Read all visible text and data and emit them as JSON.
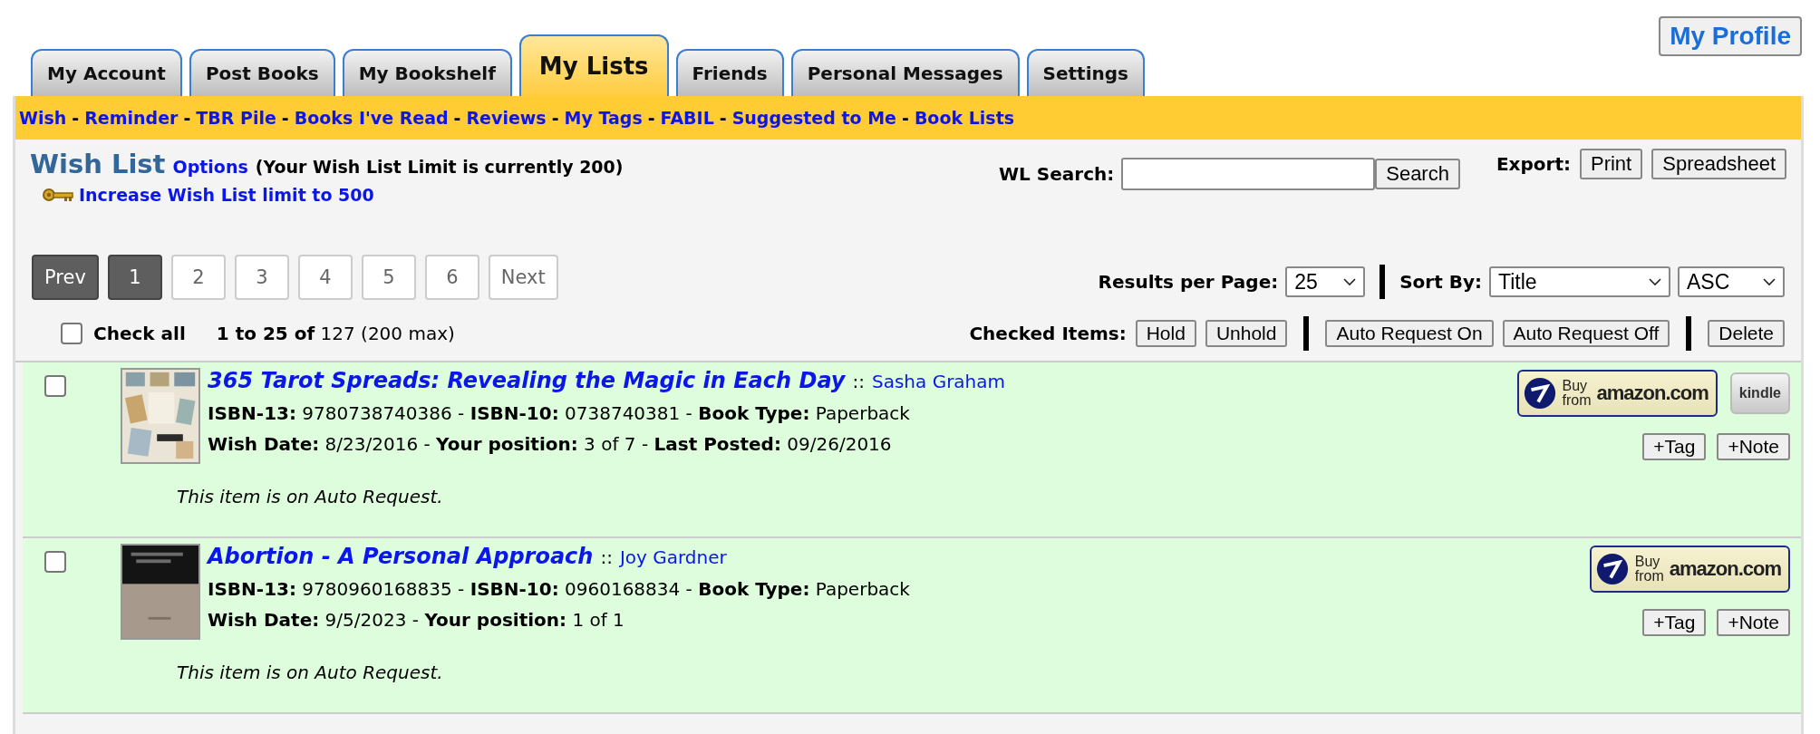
{
  "profile_button": {
    "label": "My Profile"
  },
  "tabs": [
    {
      "label": "My Account",
      "selected": false
    },
    {
      "label": "Post Books",
      "selected": false
    },
    {
      "label": "My Bookshelf",
      "selected": false
    },
    {
      "label": "My Lists",
      "selected": true
    },
    {
      "label": "Friends",
      "selected": false
    },
    {
      "label": "Personal Messages",
      "selected": false
    },
    {
      "label": "Settings",
      "selected": false
    }
  ],
  "subnav": {
    "separator": "-",
    "links": [
      "Wish",
      "Reminder",
      "TBR Pile",
      "Books I've Read",
      "Reviews",
      "My Tags",
      "FABIL",
      "Suggested to Me",
      "Book Lists"
    ]
  },
  "heading": {
    "title": "Wish List",
    "options_link": "Options",
    "note": "(Your Wish List Limit is currently 200)",
    "upgrade_link": "Increase Wish List limit to 500"
  },
  "search": {
    "label": "WL Search:",
    "button": "Search"
  },
  "export": {
    "label": "Export:",
    "buttons": [
      "Print",
      "Spreadsheet"
    ]
  },
  "pager": [
    {
      "label": "Prev",
      "highlighted": true
    },
    {
      "label": "1",
      "highlighted": true
    },
    {
      "label": "2",
      "highlighted": false
    },
    {
      "label": "3",
      "highlighted": false
    },
    {
      "label": "4",
      "highlighted": false
    },
    {
      "label": "5",
      "highlighted": false
    },
    {
      "label": "6",
      "highlighted": false
    },
    {
      "label": "Next",
      "highlighted": false
    }
  ],
  "results_per_page": {
    "label": "Results per Page:",
    "value": "25"
  },
  "sort": {
    "label": "Sort By:",
    "value": "Title",
    "order": "ASC"
  },
  "check_all": {
    "label": "Check all",
    "checked": false
  },
  "count": "**1 to 25 of** 127 (200 max)",
  "checked_items": {
    "label": "Checked Items:",
    "groups": [
      [
        "Hold",
        "Unhold"
      ],
      [
        "Auto Request On",
        "Auto Request Off"
      ],
      [
        "Delete"
      ]
    ]
  },
  "books": [
    {
      "checked": false,
      "title": "365 Tarot Spreads: Revealing the Magic in Each Day",
      "separator": "::",
      "author": "Sasha Graham",
      "lines": [
        "**ISBN-13:** 9780738740386 - **ISBN-10:** 0738740381 - **Book Type:** Paperback",
        "**Wish Date:** 8/23/2016 - **Your position:** 3 of 7 - **Last Posted:** 09/26/2016"
      ],
      "note": "This item is on Auto Request.",
      "stores": [
        {
          "kind": "amazon",
          "top": "Buy",
          "bottom": "from",
          "brand": "amazon.com"
        },
        {
          "kind": "kindle",
          "label": "kindle"
        }
      ],
      "actions": [
        "+Tag",
        "+Note"
      ]
    },
    {
      "checked": false,
      "title": "Abortion - A Personal Approach",
      "separator": "::",
      "author": "Joy Gardner",
      "lines": [
        "**ISBN-13:** 9780960168835 - **ISBN-10:** 0960168834 - **Book Type:** Paperback",
        "**Wish Date:** 9/5/2023 - **Your position:** 1 of 1"
      ],
      "note": "This item is on Auto Request.",
      "stores": [
        {
          "kind": "amazon",
          "top": "Buy",
          "bottom": "from",
          "brand": "amazon.com"
        }
      ],
      "actions": [
        "+Tag",
        "+Note"
      ]
    }
  ]
}
